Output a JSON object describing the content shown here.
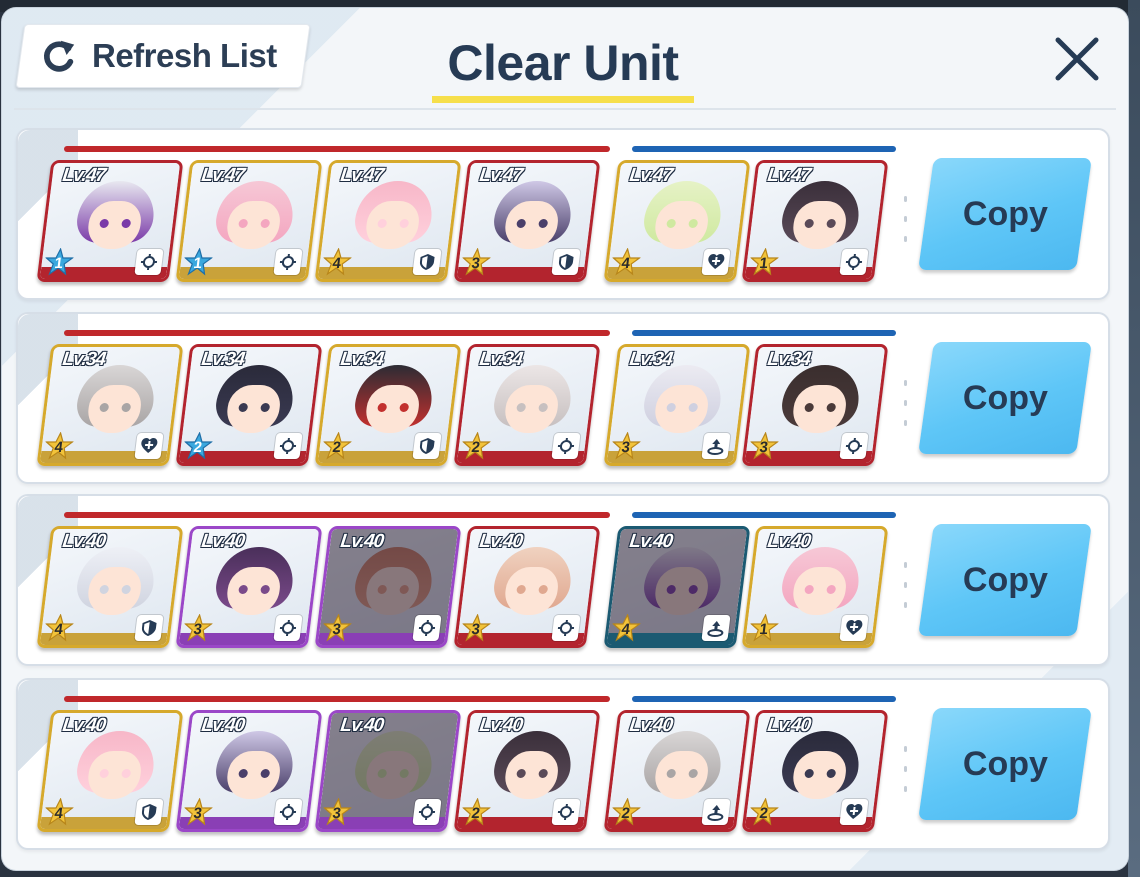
{
  "header": {
    "refresh_label": "Refresh List",
    "title": "Clear Unit",
    "title_underline_color": "#f6df4b"
  },
  "colors": {
    "striker_bar": "#c0282b",
    "special_bar": "#1e64b4",
    "copy_button": "#5ec6f7"
  },
  "rows": [
    {
      "copy_label": "Copy",
      "strikers": [
        {
          "level": "Lv.47",
          "star": "1",
          "star_type": "blue",
          "role": "crosshair-icon",
          "frame": "red"
        },
        {
          "level": "Lv.47",
          "star": "1",
          "star_type": "blue",
          "role": "crosshair-icon",
          "frame": "gold"
        },
        {
          "level": "Lv.47",
          "star": "4",
          "star_type": "gold",
          "role": "shield-icon",
          "frame": "gold"
        },
        {
          "level": "Lv.47",
          "star": "3",
          "star_type": "gold",
          "role": "shield-icon",
          "frame": "red"
        }
      ],
      "specials": [
        {
          "level": "Lv.47",
          "star": "4",
          "star_type": "gold",
          "role": "heal-icon",
          "frame": "gold"
        },
        {
          "level": "Lv.47",
          "star": "1",
          "star_type": "gold",
          "role": "crosshair-icon",
          "frame": "red"
        }
      ]
    },
    {
      "copy_label": "Copy",
      "strikers": [
        {
          "level": "Lv.34",
          "star": "4",
          "star_type": "gold",
          "role": "heal-icon",
          "frame": "gold"
        },
        {
          "level": "Lv.34",
          "star": "2",
          "star_type": "blue",
          "role": "crosshair-icon",
          "frame": "red"
        },
        {
          "level": "Lv.34",
          "star": "2",
          "star_type": "gold",
          "role": "shield-icon",
          "frame": "gold"
        },
        {
          "level": "Lv.34",
          "star": "2",
          "star_type": "gold",
          "role": "crosshair-icon",
          "frame": "red"
        }
      ],
      "specials": [
        {
          "level": "Lv.34",
          "star": "3",
          "star_type": "gold",
          "role": "support-icon",
          "frame": "gold"
        },
        {
          "level": "Lv.34",
          "star": "3",
          "star_type": "gold",
          "role": "crosshair-icon",
          "frame": "red"
        }
      ]
    },
    {
      "copy_label": "Copy",
      "strikers": [
        {
          "level": "Lv.40",
          "star": "4",
          "star_type": "gold",
          "role": "shield-icon",
          "frame": "gold"
        },
        {
          "level": "Lv.40",
          "star": "3",
          "star_type": "gold",
          "role": "crosshair-icon",
          "frame": "purple"
        },
        {
          "level": "Lv.40",
          "star": "3",
          "star_type": "gold",
          "role": "crosshair-icon",
          "frame": "purple",
          "dim": true
        },
        {
          "level": "Lv.40",
          "star": "3",
          "star_type": "gold",
          "role": "crosshair-icon",
          "frame": "red"
        }
      ],
      "specials": [
        {
          "level": "Lv.40",
          "star": "4",
          "star_type": "gold",
          "role": "support-icon",
          "frame": "teal",
          "dim": true
        },
        {
          "level": "Lv.40",
          "star": "1",
          "star_type": "gold",
          "role": "heal-icon",
          "frame": "gold"
        }
      ]
    },
    {
      "copy_label": "Copy",
      "strikers": [
        {
          "level": "Lv.40",
          "star": "4",
          "star_type": "gold",
          "role": "shield-icon",
          "frame": "gold"
        },
        {
          "level": "Lv.40",
          "star": "3",
          "star_type": "gold",
          "role": "crosshair-icon",
          "frame": "purple"
        },
        {
          "level": "Lv.40",
          "star": "3",
          "star_type": "gold",
          "role": "crosshair-icon",
          "frame": "purple",
          "dim": true
        },
        {
          "level": "Lv.40",
          "star": "2",
          "star_type": "gold",
          "role": "crosshair-icon",
          "frame": "red"
        }
      ],
      "specials": [
        {
          "level": "Lv.40",
          "star": "2",
          "star_type": "gold",
          "role": "support-icon",
          "frame": "red"
        },
        {
          "level": "Lv.40",
          "star": "2",
          "star_type": "gold",
          "role": "heal-icon",
          "frame": "red"
        }
      ]
    }
  ]
}
